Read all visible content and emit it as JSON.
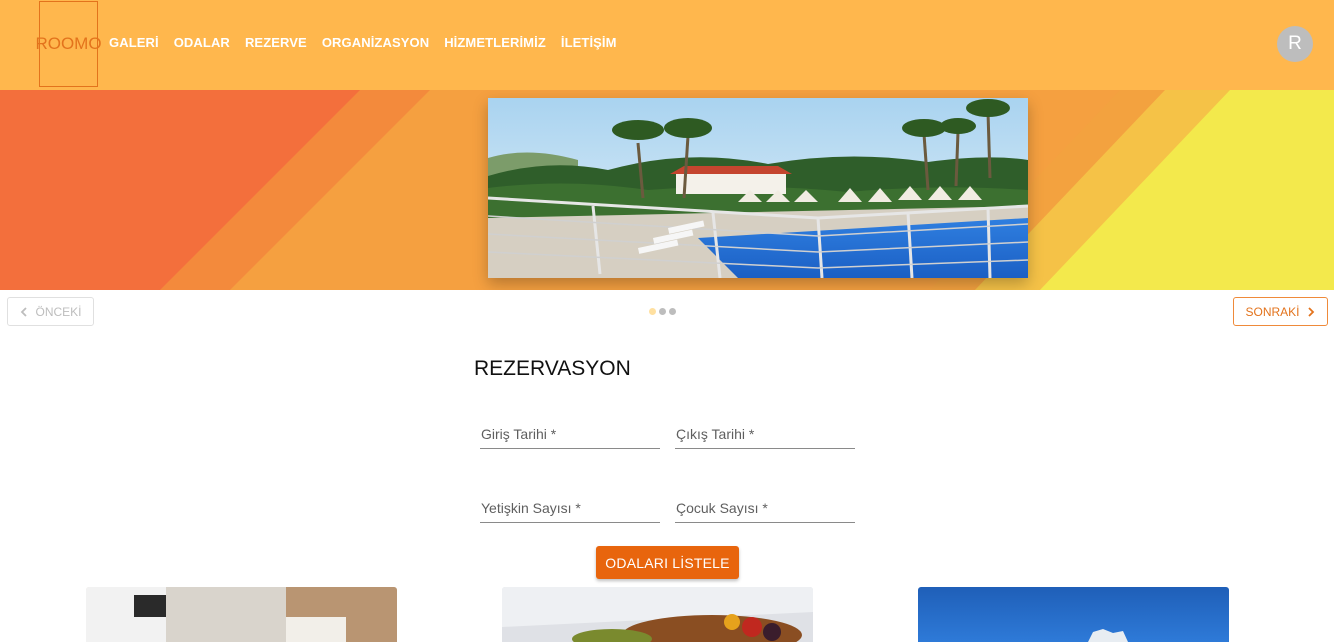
{
  "header": {
    "logo_text": "ROOMO",
    "nav": [
      "GALERİ",
      "ODALAR",
      "REZERVE",
      "ORGANİZASYON",
      "HİZMETLERİMİZ",
      "İLETİŞİM"
    ],
    "avatar_initial": "R"
  },
  "carousel": {
    "prev_label": "ÖNCEKİ",
    "next_label": "SONRAKİ",
    "slide_count": 3,
    "active_slide": 0
  },
  "reservation": {
    "title": "REZERVASYON",
    "checkin_label": "Giriş Tarihi *",
    "checkout_label": "Çıkış Tarihi *",
    "adults_label": "Yetişkin Sayısı *",
    "children_label": "Çocuk Sayısı *",
    "submit_label": "ODALARI LİSTELE"
  },
  "colors": {
    "header_bg": "#ffb74d",
    "accent": "#e8650d"
  }
}
